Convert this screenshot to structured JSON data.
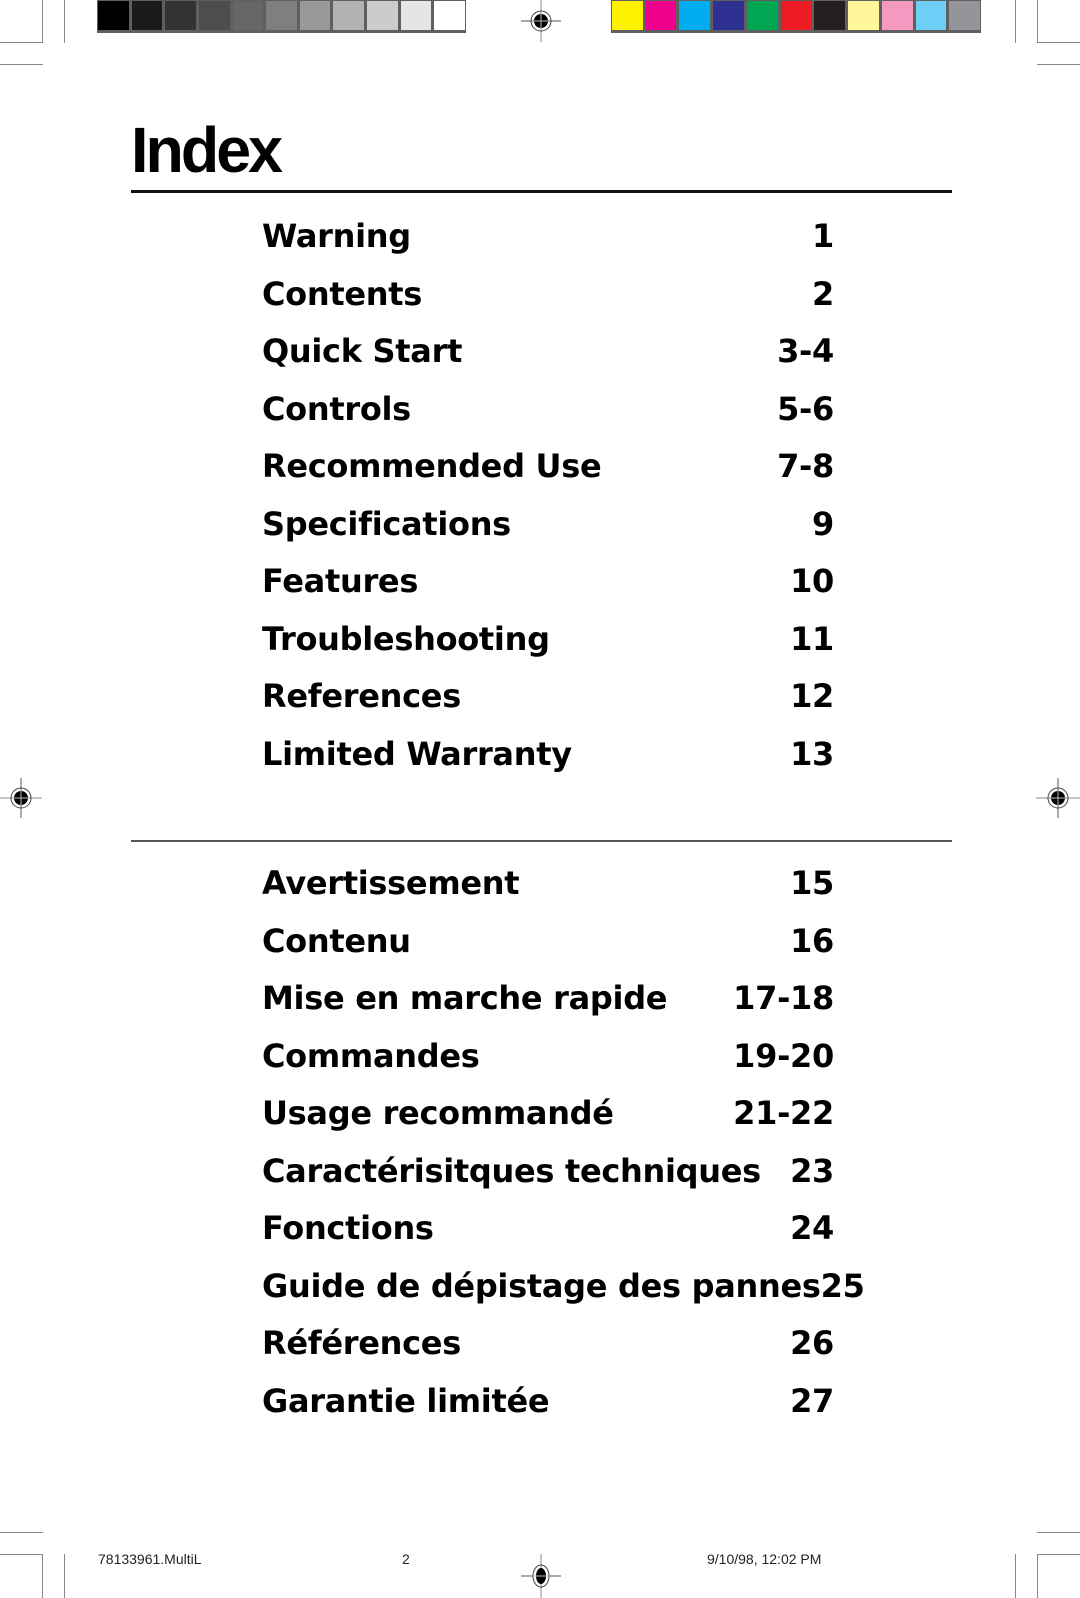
{
  "calibration": {
    "gray_swatches": [
      "#000000",
      "#1a1a1a",
      "#333333",
      "#4d4d4d",
      "#666666",
      "#7f7f7f",
      "#999999",
      "#b2b2b2",
      "#cccccc",
      "#e5e5e5",
      "#ffffff"
    ],
    "color_swatches": [
      "#fff200",
      "#ec008c",
      "#00aeef",
      "#2e3192",
      "#00a651",
      "#ed1c24",
      "#231f20",
      "#fff799",
      "#f49ac1",
      "#6dcff6",
      "#939598"
    ]
  },
  "header": {
    "title": "Index"
  },
  "english_index": [
    {
      "label": "Warning",
      "page": "1"
    },
    {
      "label": "Contents",
      "page": "2"
    },
    {
      "label": "Quick Start",
      "page": "3-4"
    },
    {
      "label": "Controls",
      "page": "5-6"
    },
    {
      "label": "Recommended Use",
      "page": "7-8"
    },
    {
      "label": "Specifications",
      "page": "9"
    },
    {
      "label": "Features",
      "page": "10"
    },
    {
      "label": "Troubleshooting",
      "page": "11"
    },
    {
      "label": "References",
      "page": "12"
    },
    {
      "label": "Limited Warranty",
      "page": "13"
    }
  ],
  "french_index": [
    {
      "label": "Avertissement",
      "page": "15"
    },
    {
      "label": "Contenu",
      "page": "16"
    },
    {
      "label": "Mise en marche rapide",
      "page": "17-18"
    },
    {
      "label": "Commandes",
      "page": "19-20"
    },
    {
      "label": "Usage recommandé",
      "page": "21-22"
    },
    {
      "label": "Caractérisitques techniques",
      "page": "23"
    },
    {
      "label": "Fonctions",
      "page": "24"
    },
    {
      "label": "Guide de dépistage des pannes",
      "page": "25"
    },
    {
      "label": "Références",
      "page": "26"
    },
    {
      "label": "Garantie limitée",
      "page": "27"
    }
  ],
  "footer": {
    "file_name": "78133961.MultiL",
    "page_number": "2",
    "timestamp": "9/10/98, 12:02 PM"
  }
}
